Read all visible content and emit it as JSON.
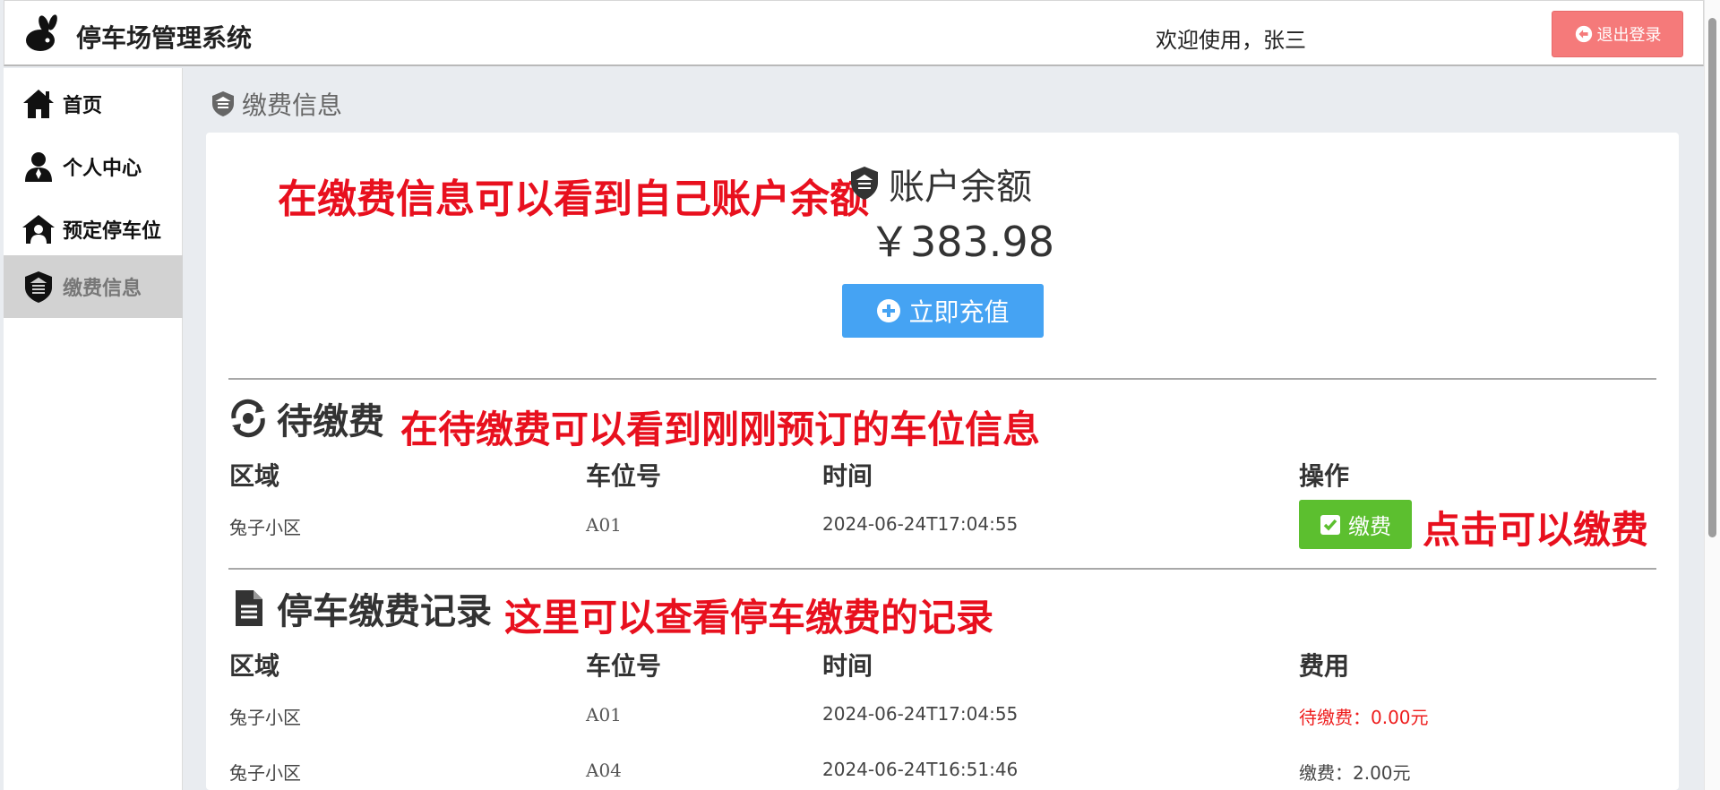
{
  "header": {
    "app_title": "停车场管理系统",
    "welcome": "欢迎使用，张三",
    "logout_label": "退出登录",
    "logout_color": "#f57a7a"
  },
  "sidebar": {
    "items": [
      {
        "label": "首页",
        "icon": "home-icon"
      },
      {
        "label": "个人中心",
        "icon": "user-icon"
      },
      {
        "label": "预定停车位",
        "icon": "parking-house-icon"
      },
      {
        "label": "缴费信息",
        "icon": "payment-shield-icon",
        "active": true
      }
    ]
  },
  "breadcrumb": "缴费信息",
  "annotations": {
    "balance_note": "在缴费信息可以看到自己账户余额",
    "pending_note": "在待缴费可以看到刚刚预订的车位信息",
    "pay_note": "点击可以缴费",
    "records_note": "这里可以查看停车缴费的记录"
  },
  "balance": {
    "title": "账户余额",
    "amount": "￥383.98",
    "recharge_label": "立即充值",
    "recharge_color": "#45a3f3"
  },
  "pending": {
    "title": "待缴费",
    "headers": [
      "区域",
      "车位号",
      "时间",
      "操作"
    ],
    "rows": [
      {
        "area": "兔子小区",
        "spot": "A01",
        "time": "2024-06-24T17:04:55",
        "action": "缴费"
      }
    ],
    "pay_color": "#5cbf2f"
  },
  "records": {
    "title": "停车缴费记录",
    "headers": [
      "区域",
      "车位号",
      "时间",
      "费用"
    ],
    "rows": [
      {
        "area": "兔子小区",
        "spot": "A01",
        "time": "2024-06-24T17:04:55",
        "fee": "待缴费：0.00元",
        "status_color": "#ee1d1d"
      },
      {
        "area": "兔子小区",
        "spot": "A04",
        "time": "2024-06-24T16:51:46",
        "fee": "缴费：2.00元"
      }
    ]
  },
  "annotation_color": "#e8101e"
}
